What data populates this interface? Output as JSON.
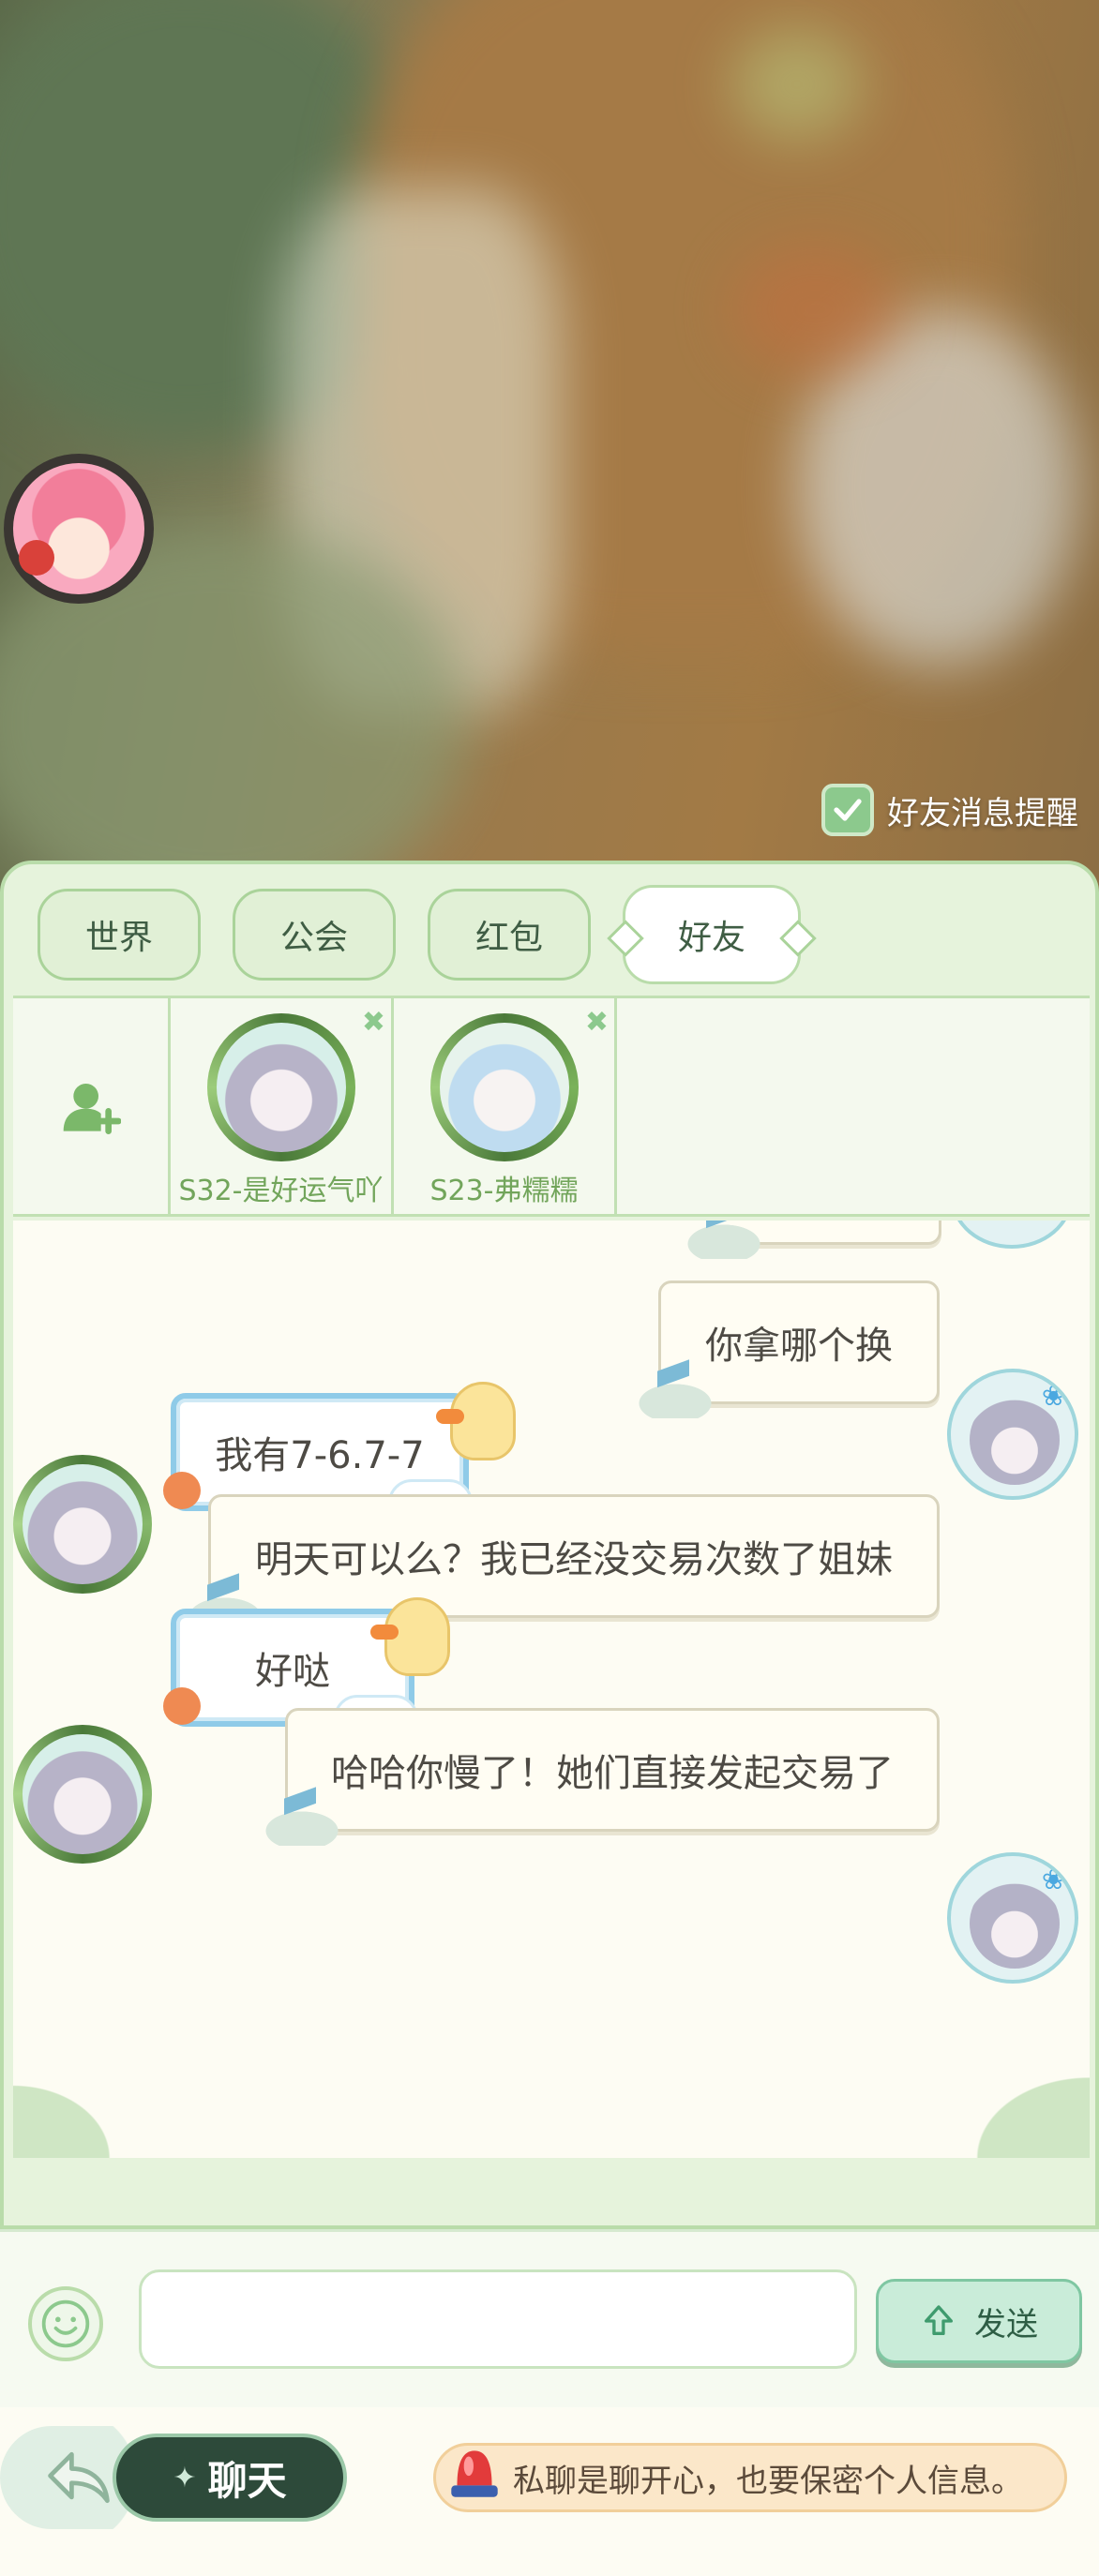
{
  "notify": {
    "label": "好友消息提醒",
    "checked": true
  },
  "tabs": [
    {
      "label": "世界",
      "active": false
    },
    {
      "label": "公会",
      "active": false
    },
    {
      "label": "红包",
      "active": false
    },
    {
      "label": "好友",
      "active": true
    }
  ],
  "friends": [
    {
      "name": "S32-是好运气吖"
    },
    {
      "name": "S23-弗糯糯"
    }
  ],
  "messages": [
    {
      "sender": "me",
      "text": "你拿哪个换"
    },
    {
      "sender": "other",
      "text": "我有7-6.7-7"
    },
    {
      "sender": "me",
      "text": "明天可以么？我已经没交易次数了姐妹"
    },
    {
      "sender": "other",
      "text": "好哒"
    },
    {
      "sender": "me",
      "text": "哈哈你慢了！她们直接发起交易了"
    }
  ],
  "input": {
    "value": ""
  },
  "send_label": "发送",
  "bottom": {
    "chat_label": "聊天",
    "warning": "私聊是聊开心，也要保密个人信息。"
  },
  "colors": {
    "accent_green": "#b9dcaa",
    "send_bg": "#c9ecd9",
    "bubble_other_border": "#8fcbe8"
  }
}
